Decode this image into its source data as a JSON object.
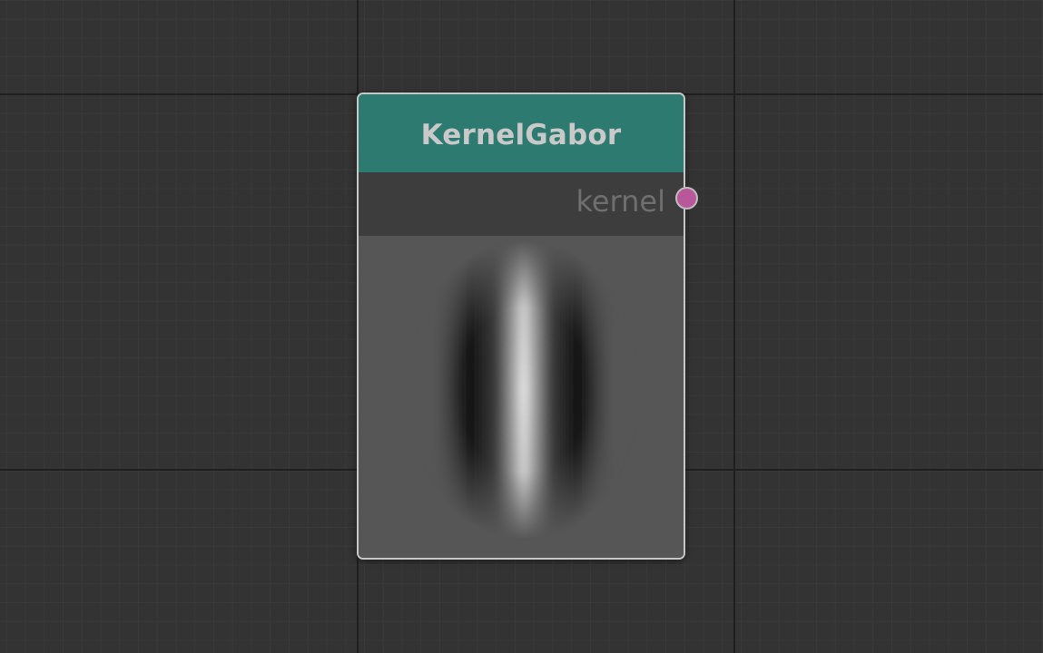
{
  "node": {
    "title": "KernelGabor",
    "header_color": "#2c7a70",
    "output_port": {
      "label": "kernel",
      "color": "#b8589b"
    }
  },
  "preview": {
    "kind": "gabor-kernel-image"
  }
}
